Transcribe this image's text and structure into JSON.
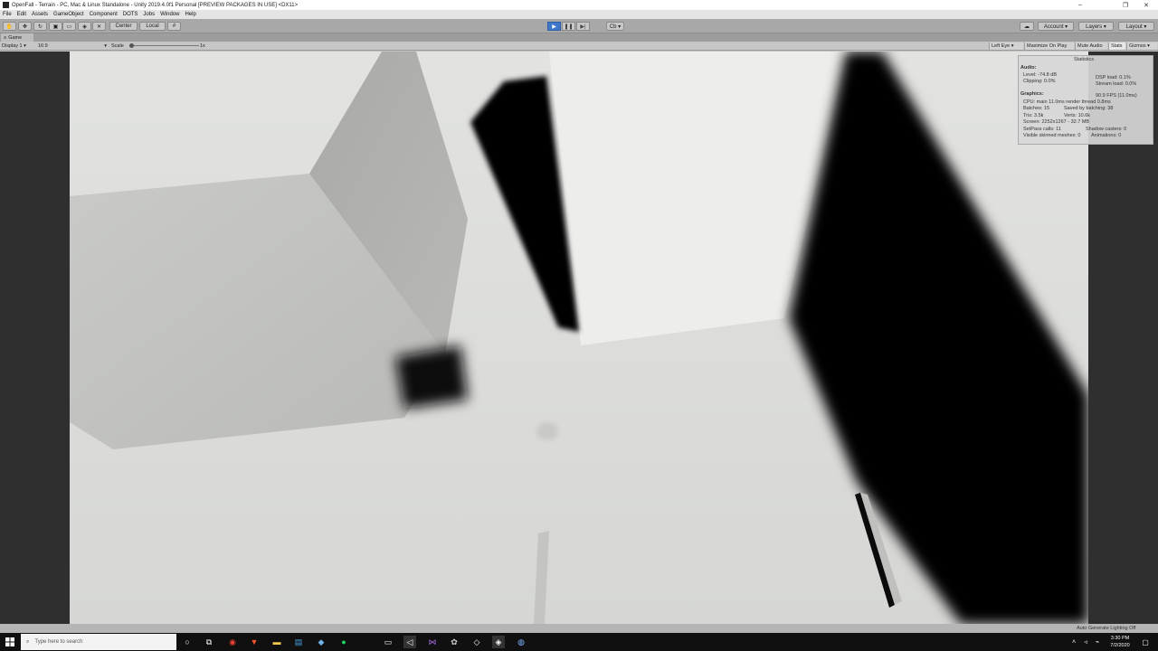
{
  "window": {
    "title": "OpenFall - Terrain - PC, Mac & Linux Standalone - Unity 2019.4.0f1 Personal [PREVIEW PACKAGES IN USE] <DX11>",
    "minimize": "–",
    "maximize": "❐",
    "close": "✕"
  },
  "menu": [
    "File",
    "Edit",
    "Assets",
    "GameObject",
    "Component",
    "DOTS",
    "Jobs",
    "Window",
    "Help"
  ],
  "toolbar": {
    "pivot": "Center",
    "space": "Local",
    "collab": "Cb ▾",
    "account": "Account ▾",
    "layers": "Layers ▾",
    "layout": "Layout ▾"
  },
  "tab": {
    "label": "Game"
  },
  "gamebar": {
    "display": "Display 1",
    "aspect": "16:9",
    "scale_label": "Scale",
    "scale_value": "1x",
    "eye": "Left Eye",
    "maximize": "Maximize On Play",
    "mute": "Mute Audio",
    "stats": "Stats",
    "gizmos": "Gizmos"
  },
  "stats": {
    "title": "Statistics",
    "audio_label": "Audio:",
    "level": "Level: -74.8 dB",
    "clipping": "Clipping: 0.0%",
    "dsp": "DSP load: 0.1%",
    "stream": "Stream load: 0.0%",
    "graphics_label": "Graphics:",
    "fps": "90.9 FPS (11.0ms)",
    "cpu": "CPU: main 11.0ms  render thread 0.8ms",
    "batches": "Batches: 15",
    "saved": "Saved by batching: 38",
    "tris": "Tris: 3.5k",
    "verts": "Verts: 10.6k",
    "screen": "Screen: 2252x1267 - 32.7 MB",
    "setpass": "SetPass calls: 11",
    "shadow": "Shadow casters: 0",
    "skinned": "Visible skinned meshes: 0",
    "animations": "Animations: 0"
  },
  "status": {
    "lighting": "Auto Generate Lighting Off"
  },
  "taskbar": {
    "search_placeholder": "Type here to search",
    "time": "3:30 PM",
    "date": "7/2/2020"
  }
}
